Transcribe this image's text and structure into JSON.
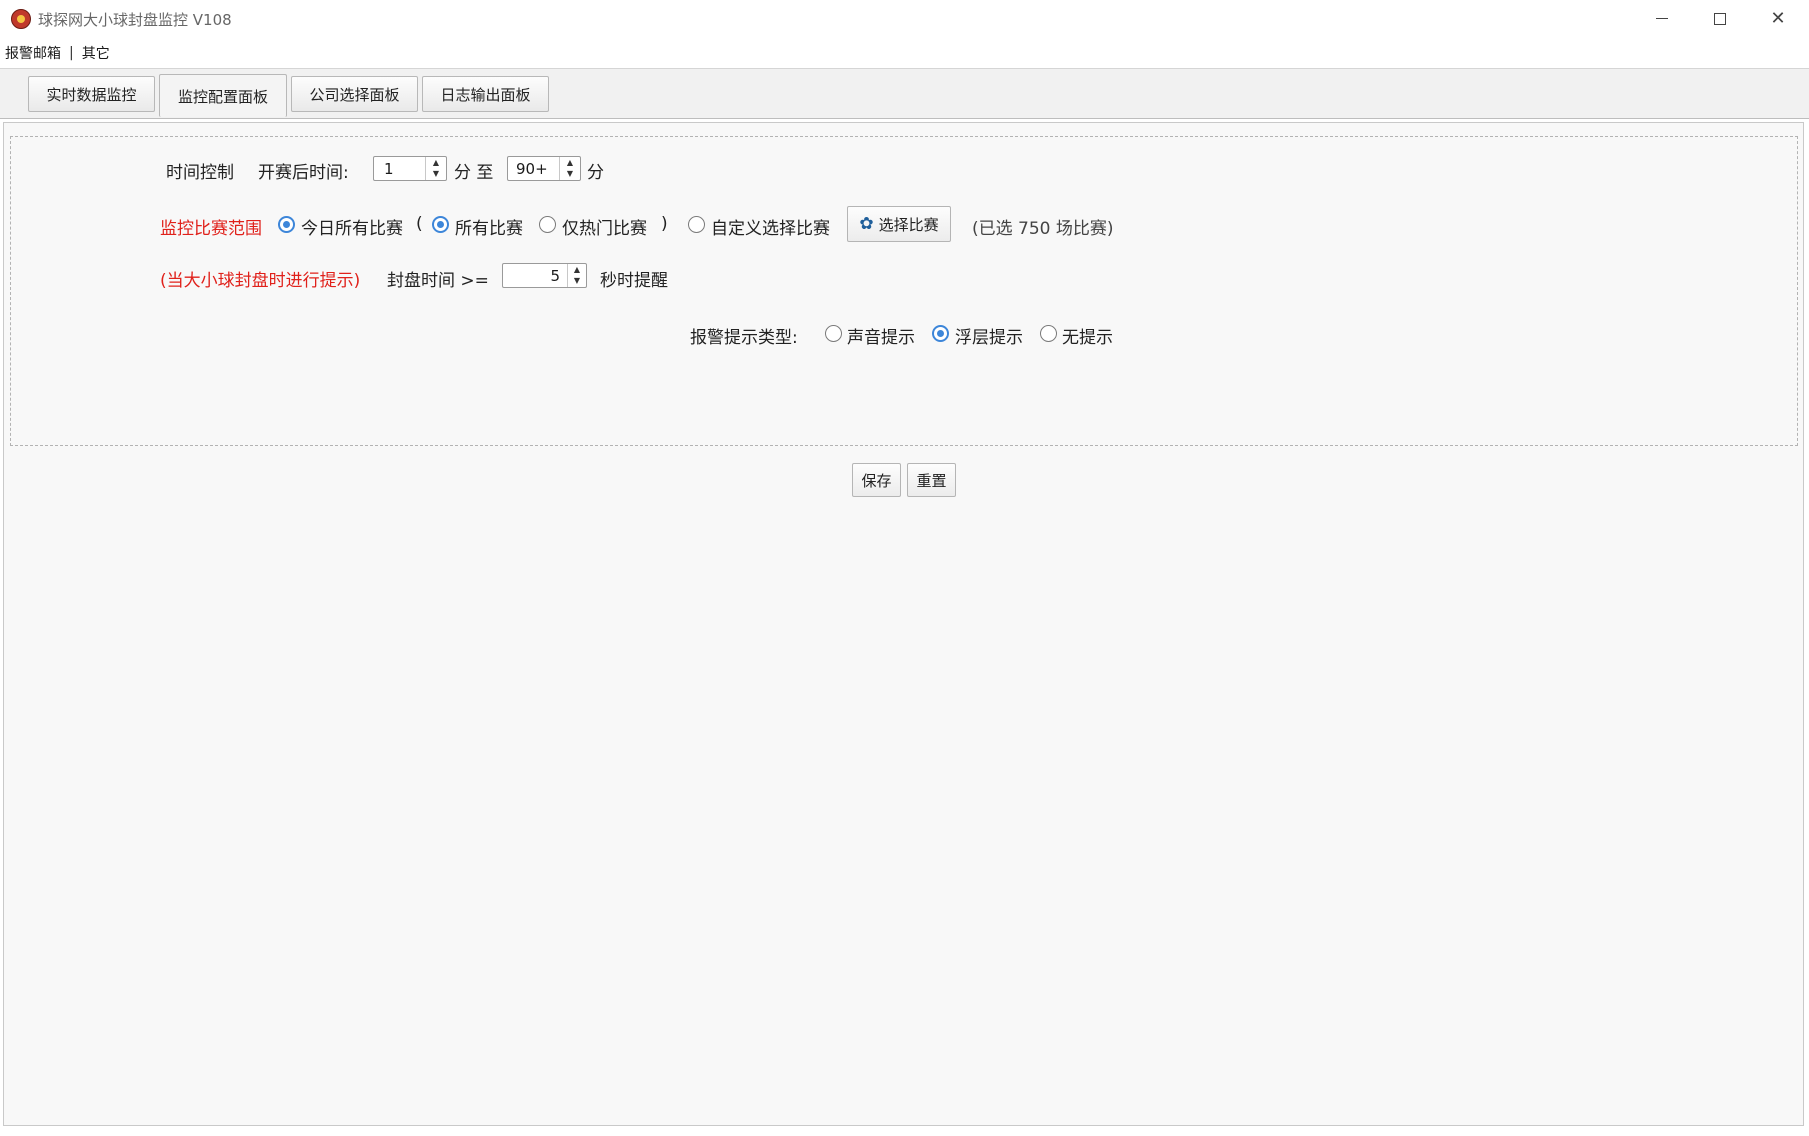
{
  "window": {
    "title": "球探网大小球封盘监控 V108",
    "minimize_glyph": "",
    "close_glyph": "✕"
  },
  "menu": {
    "items": [
      "报警邮箱",
      "其它"
    ],
    "separator": "|"
  },
  "tabs": [
    {
      "label": "实时数据监控",
      "active": false
    },
    {
      "label": "监控配置面板",
      "active": true
    },
    {
      "label": "公司选择面板",
      "active": false
    },
    {
      "label": "日志输出面板",
      "active": false
    }
  ],
  "time_control": {
    "section_label": "时间控制",
    "after_start_label": "开赛后时间:",
    "from_value": "1",
    "unit_min_to": "分 至",
    "to_value": "90+",
    "unit_min": "分"
  },
  "scope": {
    "label": "监控比赛范围",
    "today_all": "今日所有比赛",
    "paren_open": "(",
    "all_matches": "所有比赛",
    "hot_only": "仅热门比赛",
    "paren_close": ")",
    "custom": "自定义选择比赛",
    "select_button": "选择比赛",
    "selected_note": "(已选 750 场比赛)",
    "selected_today": true,
    "selected_sub": "all_matches"
  },
  "seal": {
    "hint": "(当大小球封盘时进行提示)",
    "label": "封盘时间 >=",
    "value": "5",
    "suffix": "秒时提醒"
  },
  "alert": {
    "label": "报警提示类型:",
    "options": [
      "声音提示",
      "浮层提示",
      "无提示"
    ],
    "selected": "浮层提示"
  },
  "actions": {
    "save": "保存",
    "reset": "重置"
  },
  "colors": {
    "accent": "#3d86d9",
    "warning_text": "#e0211b"
  }
}
